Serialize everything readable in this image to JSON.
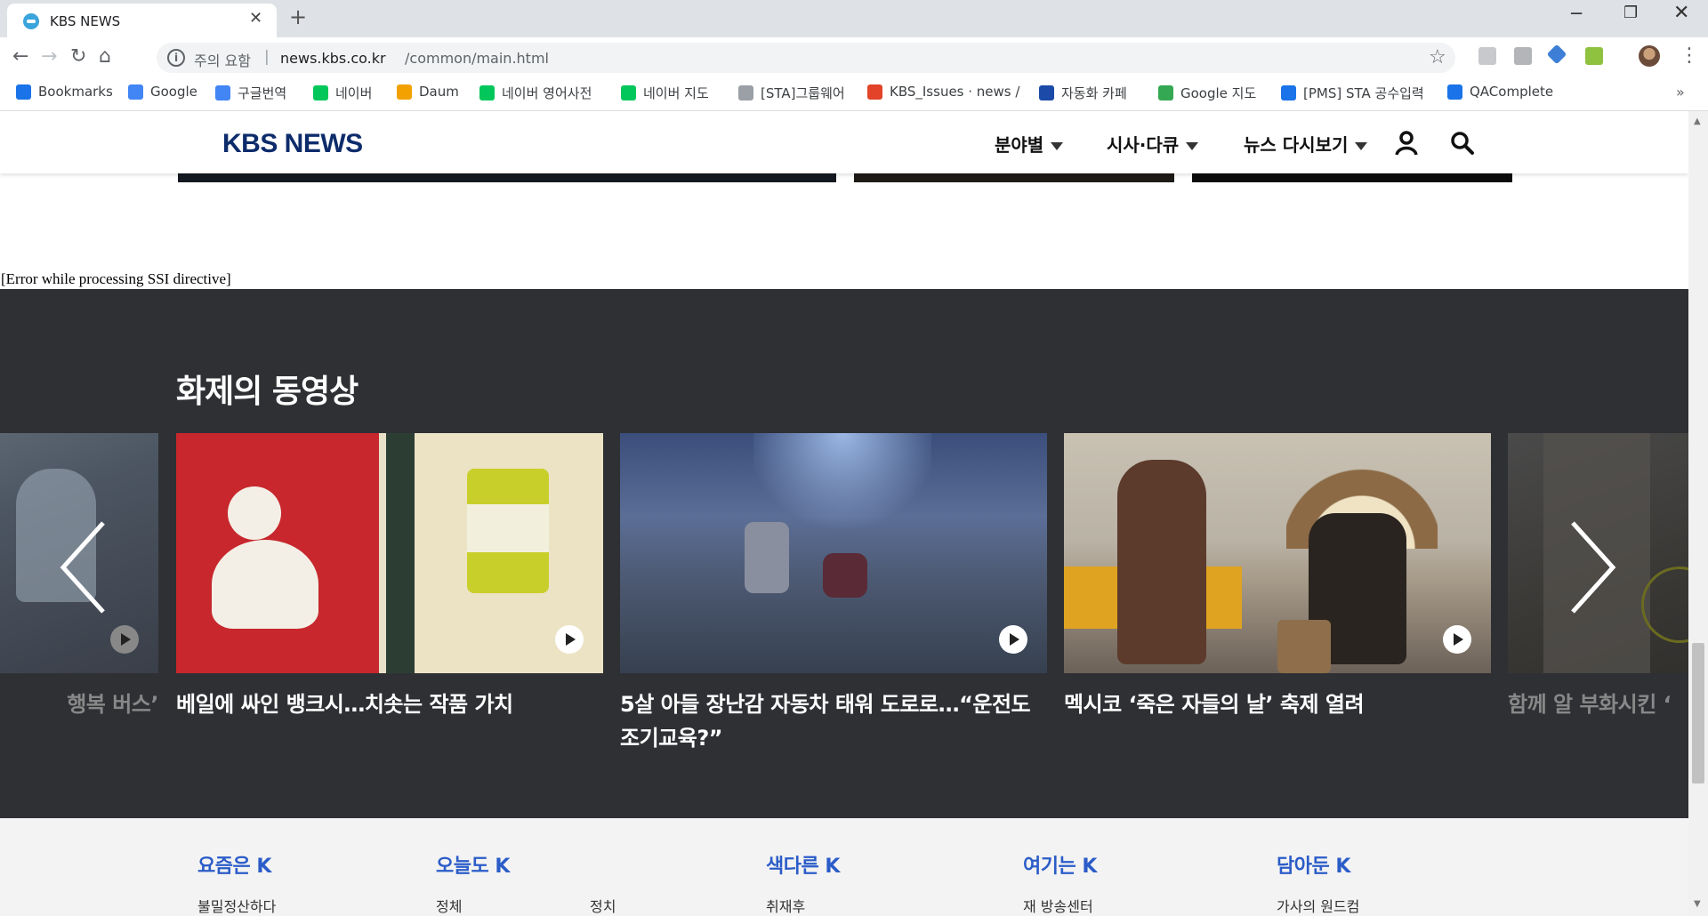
{
  "browser": {
    "tab_title": "KBS NEWS",
    "security_label": "주의 요함",
    "url_separator": "|",
    "url_host": "news.kbs.co.kr",
    "url_path": "/common/main.html",
    "bookmarks": [
      {
        "label": "Bookmarks",
        "icon": "star-icon",
        "color": "#1a73e8"
      },
      {
        "label": "Google",
        "icon": "google-icon",
        "color": "#4285f4"
      },
      {
        "label": "구글번역",
        "icon": "translate-icon",
        "color": "#4285f4"
      },
      {
        "label": "네이버",
        "icon": "naver-icon",
        "color": "#03c75a"
      },
      {
        "label": "Daum",
        "icon": "daum-icon",
        "color": "#f2a100"
      },
      {
        "label": "네이버 영어사전",
        "icon": "dict-icon",
        "color": "#03c75a"
      },
      {
        "label": "네이버 지도",
        "icon": "naver-icon",
        "color": "#03c75a"
      },
      {
        "label": "[STA]그룹웨어",
        "icon": "page-icon",
        "color": "#9aa0a6"
      },
      {
        "label": "KBS_Issues · news /",
        "icon": "gitlab-icon",
        "color": "#e24329"
      },
      {
        "label": "자동화 카페",
        "icon": "sta-icon",
        "color": "#1c4aa8"
      },
      {
        "label": "Google 지도",
        "icon": "maps-icon",
        "color": "#34a853"
      },
      {
        "label": "[PMS] STA 공수입력",
        "icon": "pms-icon",
        "color": "#1a73e8"
      },
      {
        "label": "QAComplete",
        "icon": "qa-icon",
        "color": "#1a73e8"
      }
    ],
    "bookmarks_more": "»"
  },
  "site": {
    "logo": "KBS NEWS",
    "nav": [
      "분야별",
      "시사·다큐",
      "뉴스 다시보기"
    ],
    "ssi_error": "[Error while processing SSI directive]"
  },
  "videos": {
    "section_title": "화제의 동영상",
    "cards": [
      {
        "title": "행복 버스’"
      },
      {
        "title": "베일에 싸인 뱅크시…치솟는 작품 가치"
      },
      {
        "title": "5살 아들 장난감 자동차 태워 도로로…“운전도 조기교육?”"
      },
      {
        "title": "멕시코 ‘죽은 자들의 날’ 축제 열려"
      },
      {
        "title": "함께 알 부화시킨 ‘"
      }
    ]
  },
  "footer": {
    "columns": [
      {
        "title": "요즘은 K",
        "items": [
          "불밀정산하다"
        ]
      },
      {
        "title": "오늘도 K",
        "items": [
          "정체",
          "정치"
        ]
      },
      {
        "title": "색다른 K",
        "items": [
          "취재후"
        ]
      },
      {
        "title": "여기는 K",
        "items": [
          "재 방송센터"
        ]
      },
      {
        "title": "담아둔 K",
        "items": [
          "가사의 원드컴"
        ]
      }
    ]
  },
  "colors": {
    "section_bg": "#2e3034",
    "logo": "#0d2c6b",
    "footer_heading": "#2b5cc8"
  }
}
